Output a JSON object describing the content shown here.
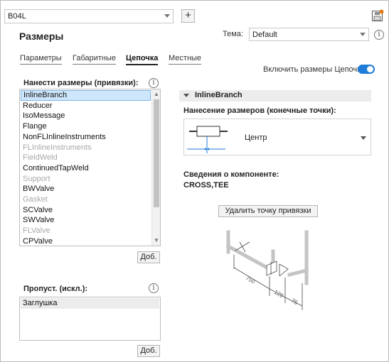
{
  "top_combo": {
    "value": "B04L"
  },
  "header": {
    "add_label": "+",
    "title": "Размеры",
    "tema_label": "Тема:",
    "tema_value": "Default"
  },
  "tabs": [
    {
      "label": "Параметры",
      "active": false
    },
    {
      "label": "Габаритные",
      "active": false
    },
    {
      "label": "Цепочка",
      "active": true
    },
    {
      "label": "Местные",
      "active": false
    }
  ],
  "toggle": {
    "label": "Включить размеры Цепочка:",
    "on": true
  },
  "attach_section": {
    "label": "Нанести размеры (привязки):",
    "items": [
      {
        "label": "InlineBranch",
        "state": "selected"
      },
      {
        "label": "Reducer",
        "state": "normal"
      },
      {
        "label": "IsoMessage",
        "state": "normal"
      },
      {
        "label": "Flange",
        "state": "normal"
      },
      {
        "label": "NonFLInlineInstruments",
        "state": "normal"
      },
      {
        "label": "FLInlineInstruments",
        "state": "disabled"
      },
      {
        "label": "FieldWeld",
        "state": "disabled"
      },
      {
        "label": "ContinuedTapWeld",
        "state": "normal"
      },
      {
        "label": "Support",
        "state": "disabled"
      },
      {
        "label": "BWValve",
        "state": "normal"
      },
      {
        "label": "Gasket",
        "state": "disabled"
      },
      {
        "label": "SCValve",
        "state": "normal"
      },
      {
        "label": "SWValve",
        "state": "normal"
      },
      {
        "label": "FLValve",
        "state": "disabled"
      },
      {
        "label": "CPValve",
        "state": "normal"
      }
    ],
    "add_button": "Доб."
  },
  "skip_section": {
    "label": "Пропуст. (искл.):",
    "items": [
      {
        "label": "Заглушка",
        "state": "selected"
      }
    ],
    "add_button": "Доб."
  },
  "detail_panel": {
    "header": "InlineBranch",
    "endpoints_label": "Нанесение размеров (конечные точки):",
    "endpoints_value": "Центр",
    "component_info_label": "Сведения о компоненте:",
    "component_info_value": "CROSS,TEE",
    "delete_button": "Удалить точку привязки"
  },
  "preview_dims": [
    "750",
    "120",
    "75"
  ],
  "colors": {
    "accent": "#1f7cd8",
    "selection": "#cde6fb",
    "disabled_text": "#a8a8a8"
  }
}
